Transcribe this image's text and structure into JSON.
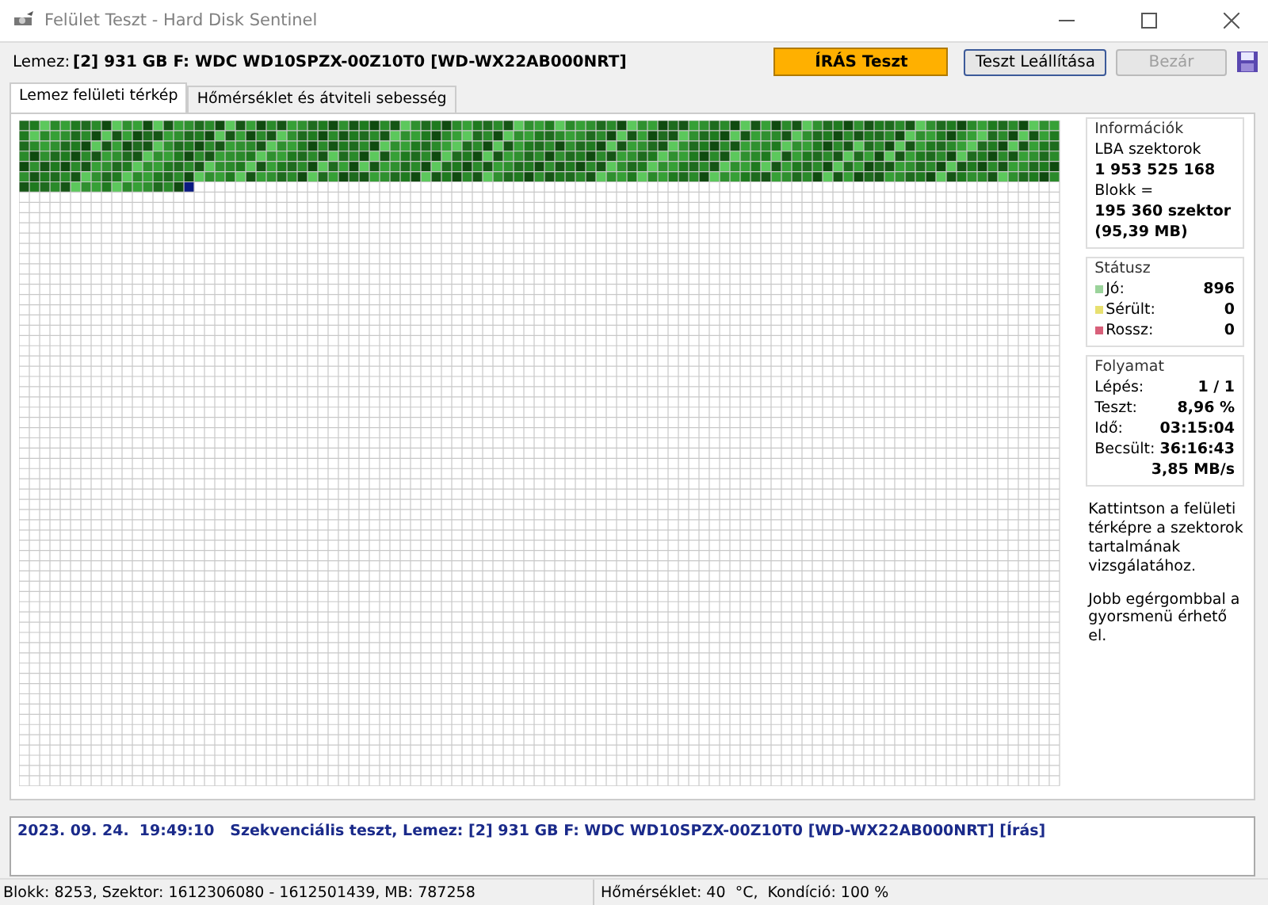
{
  "window": {
    "title": "Felület Teszt - Hard Disk Sentinel"
  },
  "toolbar": {
    "disk_label": "Lemez:",
    "disk_value": "[2] 931 GB F: WDC WD10SPZX-00Z10T0 [WD-WX22AB000NRT]",
    "test_mode": "ÍRÁS Teszt",
    "stop_button": "Teszt Leállítása",
    "close_button": {
      "label": "Bezár",
      "disabled": true
    }
  },
  "tabs": [
    {
      "label": "Lemez felületi térkép",
      "selected": true
    },
    {
      "label": "Hőmérséklet és átviteli sebesség",
      "selected": false
    }
  ],
  "info": {
    "title": "Információk",
    "lba_label": "LBA szektorok",
    "lba_value": "1 953 525 168",
    "block_label": "Blokk =",
    "block_value": "195 360 szektor",
    "block_mb": "(95,39 MB)"
  },
  "status": {
    "title": "Státusz",
    "items": [
      {
        "label": "Jó:",
        "value": "896",
        "color": "#9bd39b"
      },
      {
        "label": "Sérült:",
        "value": "0",
        "color": "#e8e070"
      },
      {
        "label": "Rossz:",
        "value": "0",
        "color": "#d8607a"
      }
    ]
  },
  "progress": {
    "title": "Folyamat",
    "rows": [
      {
        "label": "Lépés:",
        "value": "1 / 1"
      },
      {
        "label": "Teszt:",
        "value": "8,96 %"
      },
      {
        "label": "Idő:",
        "value": "03:15:04"
      },
      {
        "label": "Becsült:",
        "value": "36:16:43"
      }
    ],
    "speed": "3,85 MB/s"
  },
  "hints": [
    "Kattintson a felületi térképre a szektorok tartalmának vizsgálatához.",
    "Jobb egérgombbal a gyorsmenü érhető el."
  ],
  "log": [
    "2023. 09. 24.  19:49:10   Szekvenciális teszt, Lemez: [2] 931 GB F: WDC WD10SPZX-00Z10T0 [WD-WX22AB000NRT] [Írás]"
  ],
  "status_bar": {
    "left": "Blokk: 8253, Szektor: 1612306080 - 1612501439, MB: 787258",
    "right": "Hőmérséklet: 40  °C,  Kondíció: 100 %"
  }
}
